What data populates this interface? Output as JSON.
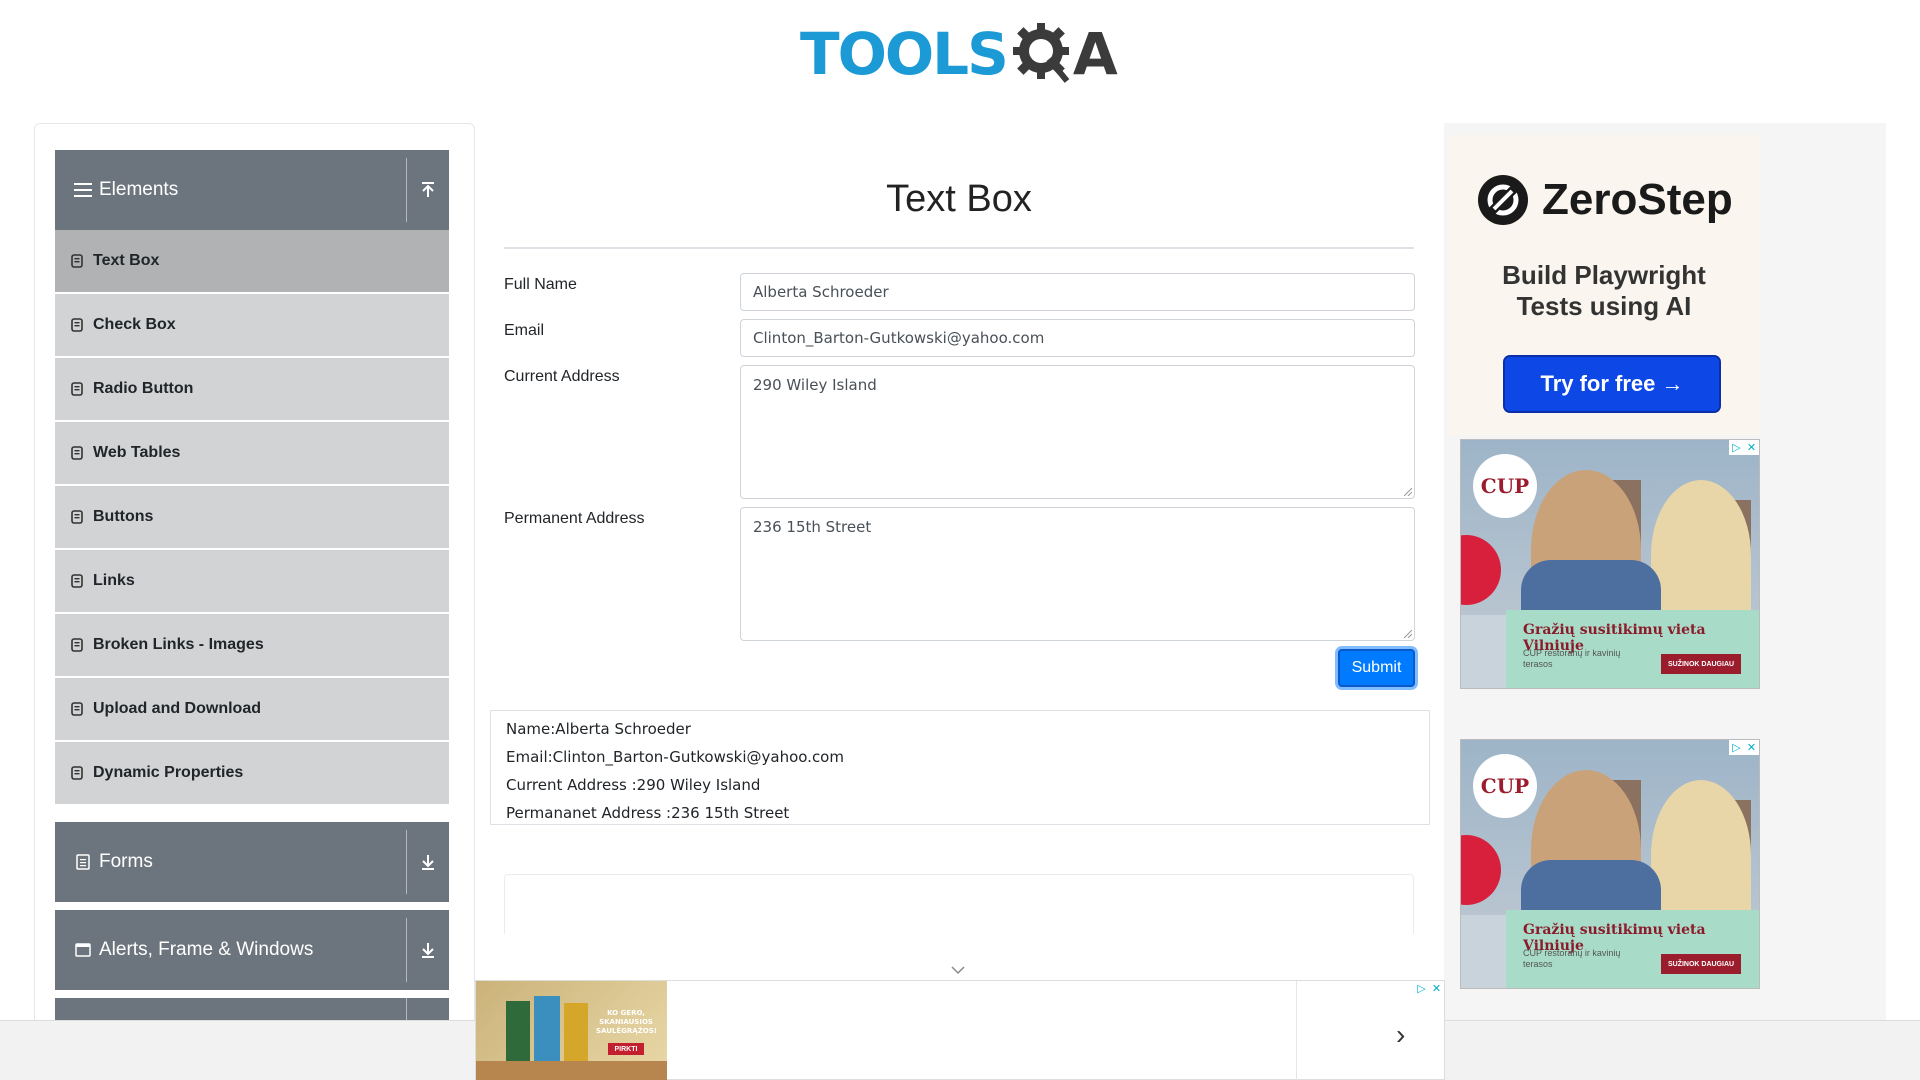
{
  "logo": {
    "text_left": "TOOLS",
    "text_right": "QA",
    "colors": {
      "tools": "#1b9ad6",
      "qa": "#3b3b3b"
    }
  },
  "sidebar": {
    "elements_group": {
      "label": "Elements",
      "icon": "hamburger-icon",
      "arrow": "collapse-up-icon"
    },
    "items": [
      {
        "label": "Text Box",
        "active": true
      },
      {
        "label": "Check Box"
      },
      {
        "label": "Radio Button"
      },
      {
        "label": "Web Tables"
      },
      {
        "label": "Buttons"
      },
      {
        "label": "Links"
      },
      {
        "label": "Broken Links - Images"
      },
      {
        "label": "Upload and Download"
      },
      {
        "label": "Dynamic Properties"
      }
    ],
    "forms_group": {
      "label": "Forms",
      "icon": "document-icon",
      "arrow": "expand-down-icon"
    },
    "alerts_group": {
      "label": "Alerts, Frame & Windows",
      "icon": "window-icon",
      "arrow": "expand-down-icon"
    }
  },
  "main": {
    "title": "Text Box",
    "fields": {
      "full_name": {
        "label": "Full Name",
        "value": "Alberta Schroeder"
      },
      "email": {
        "label": "Email",
        "value": "Clinton_Barton-Gutkowski@yahoo.com"
      },
      "current_address": {
        "label": "Current Address",
        "value": "290 Wiley Island"
      },
      "permanent_address": {
        "label": "Permanent Address",
        "value": "236 15th Street"
      }
    },
    "submit_label": "Submit",
    "output": {
      "name": "Name:Alberta Schroeder",
      "email": "Email:Clinton_Barton-Gutkowski@yahoo.com",
      "current": "Current Address :290 Wiley Island",
      "permanent": "Permananet Address :236 15th Street"
    }
  },
  "ads": {
    "zerostep": {
      "brand": "ZeroStep",
      "tagline_line1": "Build Playwright",
      "tagline_line2": "Tests using AI",
      "cta": "Try for free →"
    },
    "cup": {
      "logo": "CUP",
      "headline": "Gražių susitikimų vieta Vilniuje",
      "sub": "CUP restoranų ir kavinių terasos",
      "cta": "SUŽINOK DAUGIAU"
    },
    "bottom": {
      "promo": "KO GERO, SKANIAUSIOS SAULĖGRĄŽOS!",
      "promo_cta": "PIRKTI"
    }
  },
  "colors": {
    "accent": "#007bff",
    "sidebar_header": "#6c757d",
    "menu_item": "#d2d3d4",
    "menu_item_active": "#b0b2b4"
  }
}
